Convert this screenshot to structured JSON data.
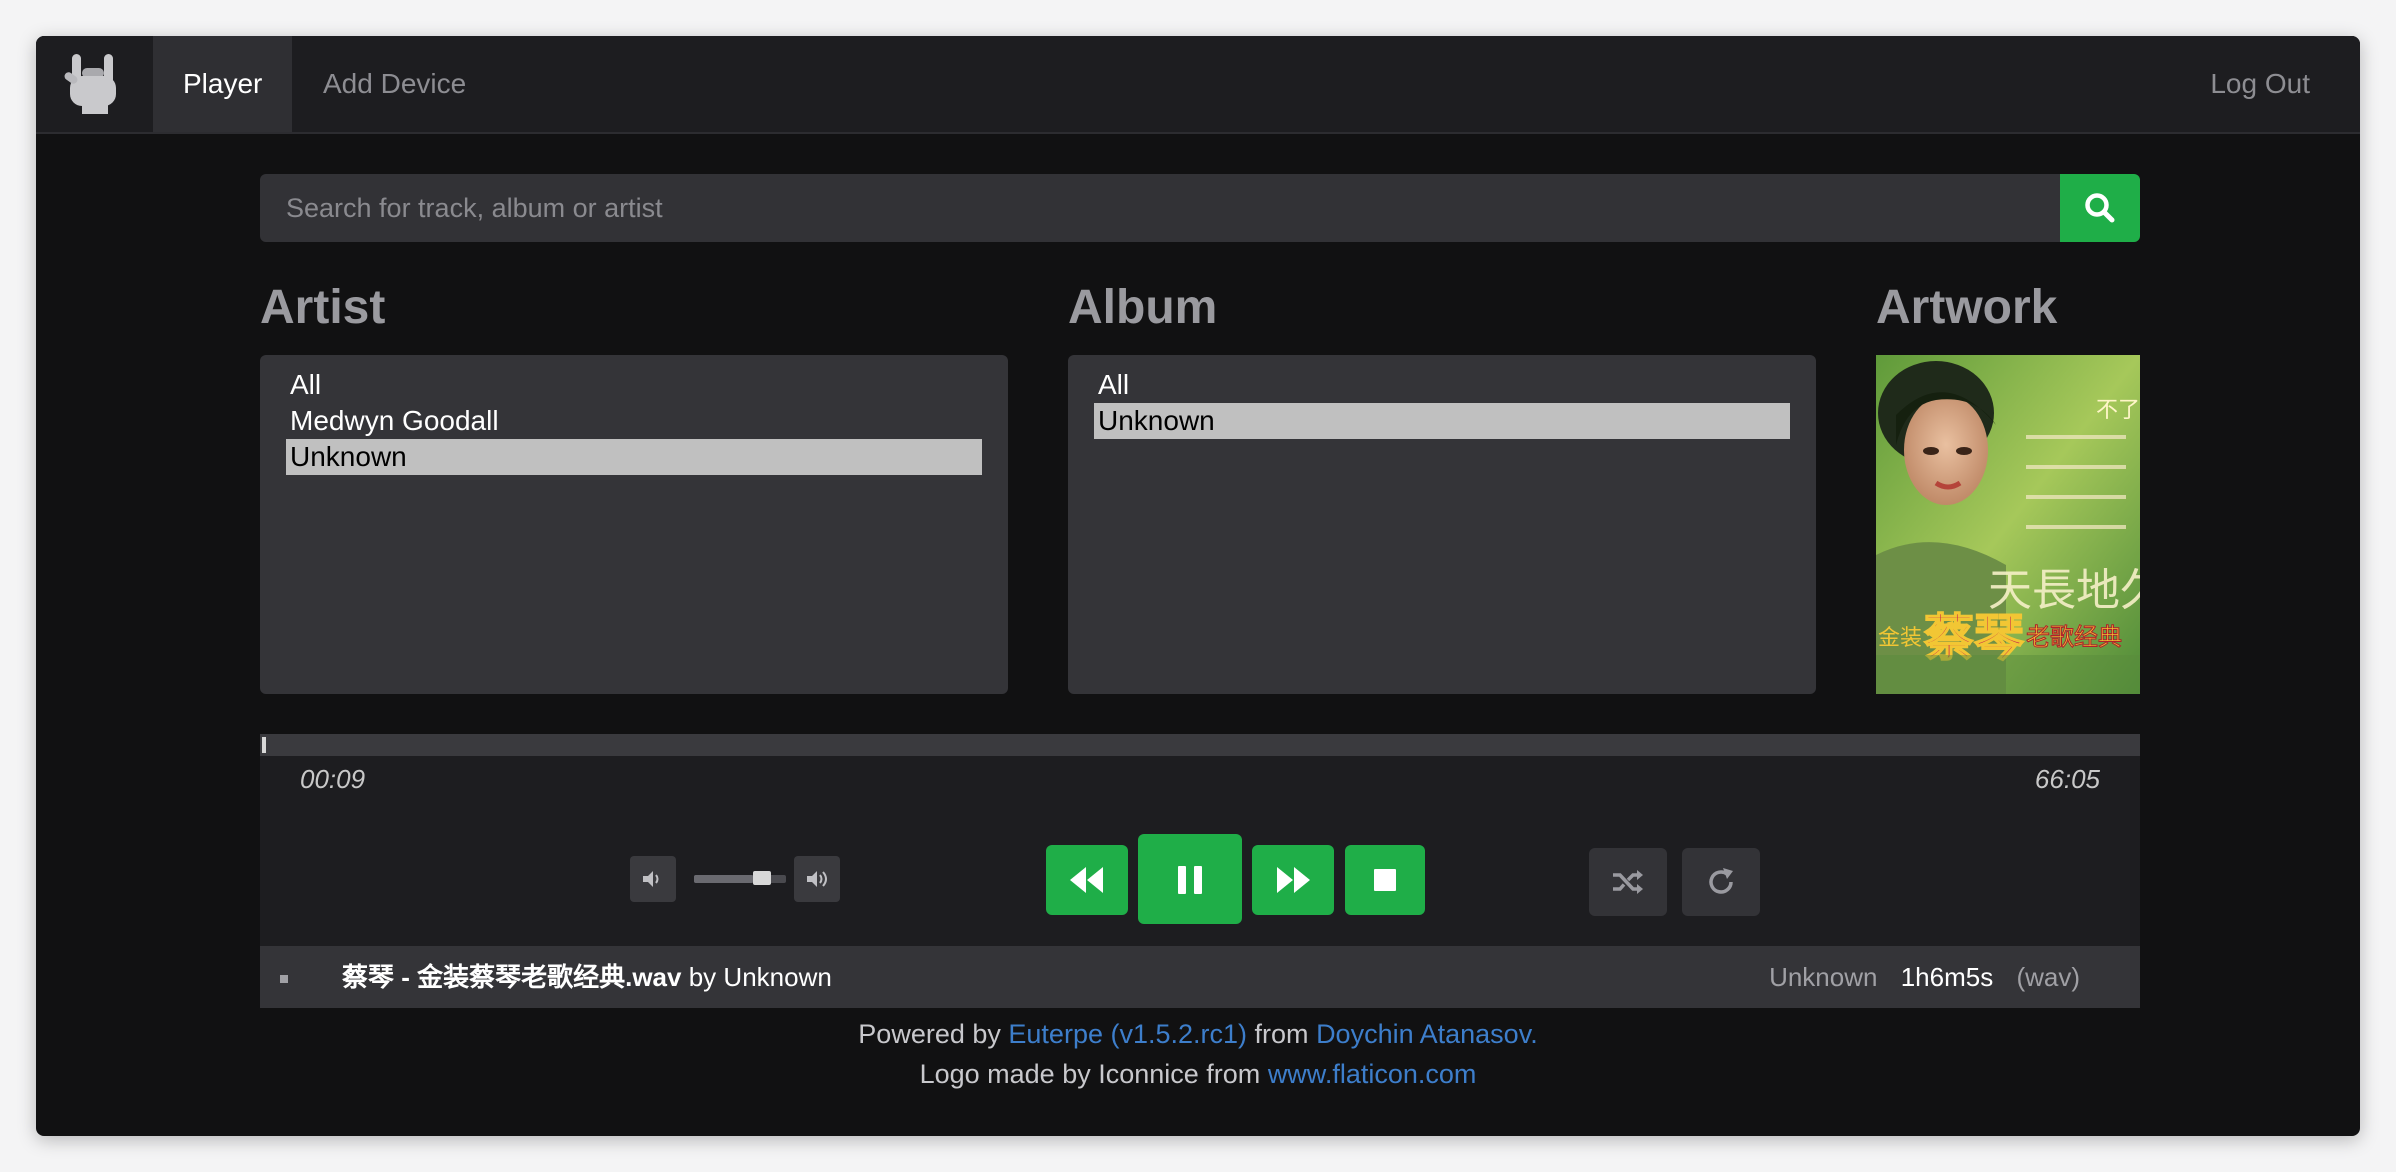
{
  "nav": {
    "tabs": [
      {
        "label": "Player",
        "active": true
      },
      {
        "label": "Add Device",
        "active": false
      }
    ],
    "logout": "Log Out",
    "logo_icon": "rock-hand-icon"
  },
  "search": {
    "placeholder": "Search for track, album or artist",
    "value": "",
    "icon": "search-icon"
  },
  "artist": {
    "title": "Artist",
    "items": [
      "All",
      "Medwyn Goodall",
      "Unknown"
    ],
    "selected": "Unknown"
  },
  "album": {
    "title": "Album",
    "items": [
      "All",
      "Unknown"
    ],
    "selected": "Unknown"
  },
  "artwork": {
    "title": "Artwork",
    "cover_text_top": "不了",
    "cover_text_mid": "天長地久",
    "cover_text_name": "蔡琴",
    "cover_text_series": "金装",
    "cover_text_tail": "老歌经典"
  },
  "player": {
    "elapsed": "00:09",
    "total": "66:05",
    "progress_fraction": 0.0023,
    "volume_fraction": 0.8,
    "controls": [
      "rewind-icon",
      "pause-icon",
      "fast-forward-icon",
      "stop-icon"
    ],
    "aux_controls": [
      "shuffle-icon",
      "repeat-icon"
    ]
  },
  "track": {
    "file": "蔡琴 - 金装蔡琴老歌经典.wav",
    "by_prefix": "by",
    "artist": "Unknown",
    "album": "Unknown",
    "duration": "1h6m5s",
    "format": "(wav)"
  },
  "footer": {
    "powered_by": "Powered by",
    "project_link": "Euterpe (v1.5.2.rc1)",
    "from": "from",
    "author_link": "Doychin Atanasov.",
    "logo_credit": "Logo made by Iconnice from",
    "flaticon_link": "www.flaticon.com"
  },
  "colors": {
    "accent_green": "#1fae48",
    "link_blue": "#3d7ecb",
    "background": "#111112",
    "panel": "#343438"
  }
}
